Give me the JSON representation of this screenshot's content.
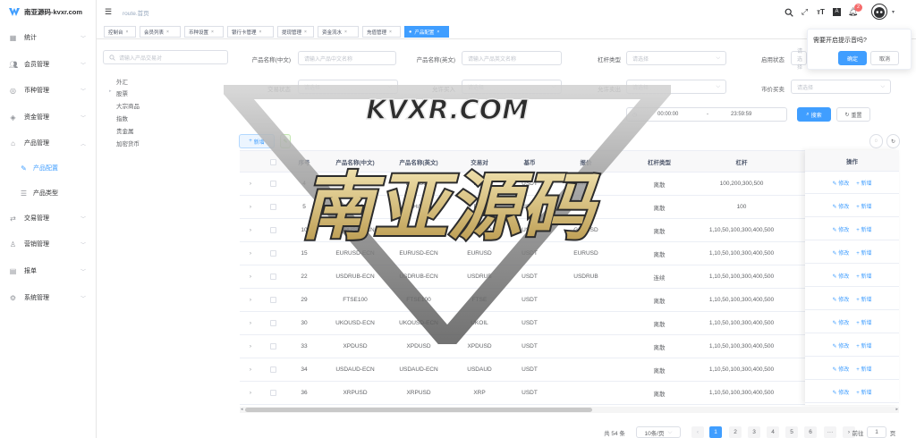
{
  "app": {
    "logo_text": "南亚源码-kvxr.com"
  },
  "sidebar": {
    "items": [
      {
        "label": "统计",
        "icon": "dashboard-icon"
      },
      {
        "label": "会员管理",
        "icon": "users-icon"
      },
      {
        "label": "币种管理",
        "icon": "coin-icon"
      },
      {
        "label": "资金管理",
        "icon": "money-icon"
      },
      {
        "label": "产品管理",
        "icon": "product-icon"
      },
      {
        "label": "产品配置",
        "icon": "edit-icon"
      },
      {
        "label": "产品类型",
        "icon": "list-icon"
      },
      {
        "label": "交易管理",
        "icon": "trade-icon"
      },
      {
        "label": "营销管理",
        "icon": "marketing-icon"
      },
      {
        "label": "报单",
        "icon": "report-icon"
      },
      {
        "label": "系统管理",
        "icon": "settings-icon"
      }
    ]
  },
  "header": {
    "breadcrumb": "route.首页",
    "notification_count": "2"
  },
  "tabs": [
    {
      "label": "控制台"
    },
    {
      "label": "会员列表"
    },
    {
      "label": "币种设置"
    },
    {
      "label": "银行卡管理"
    },
    {
      "label": "提现管理"
    },
    {
      "label": "资金流水"
    },
    {
      "label": "充值管理"
    },
    {
      "label": "产品配置"
    }
  ],
  "tree": {
    "placeholder": "请输入产品交易对",
    "nodes": [
      "外汇",
      "股票",
      "大宗商品",
      "指数",
      "贵金属",
      "加密货币"
    ]
  },
  "filters": {
    "name_cn_label": "产品名称(中文)",
    "name_cn_placeholder": "请输入产品中文名称",
    "name_en_label": "产品名称(英文)",
    "name_en_placeholder": "请输入产品英文名称",
    "leverage_type_label": "杠杆类型",
    "select_placeholder": "请选择",
    "enabled_label": "启用状态",
    "trade_status_label": "交易状态",
    "allow_buy_label": "允许买入",
    "allow_sell_label": "允许卖出",
    "market_buy_label": "市价买卖",
    "time_start": "00:00:00",
    "time_sep": "-",
    "time_end": "23:59:59",
    "search_button": "搜索",
    "reset_button": "重置",
    "add_button": "新增"
  },
  "popover": {
    "title": "需要开启提示音吗?",
    "confirm": "确定",
    "cancel": "取消"
  },
  "table": {
    "columns": [
      "序号",
      "产品名称(中文)",
      "产品名称(英文)",
      "交易对",
      "基币",
      "报价",
      "杠杆类型",
      "杠杆",
      "止损比例",
      "操作"
    ],
    "edit_label": "修改",
    "add_label": "新增",
    "rows": [
      {
        "id": "4",
        "name_cn": "BTC/USD",
        "name_en": "BTC/USD",
        "pair": "BTC",
        "base": "USDT",
        "quote": "Bitcoin",
        "lev_type": "离散",
        "leverage": "100,200,300,500",
        "stop": "0"
      },
      {
        "id": "5",
        "name_cn": "ETH/USD",
        "name_en": "ETH/USD",
        "pair": "ETH",
        "base": "USDT",
        "quote": "Ethereum",
        "lev_type": "离散",
        "leverage": "100",
        "stop": "10"
      },
      {
        "id": "10",
        "name_cn": "GBPUSD-ECN",
        "name_en": "GBPUSD-ECN",
        "pair": "GBPUSD",
        "base": "USDT",
        "quote": "GBPUSD",
        "lev_type": "离散",
        "leverage": "1,10,50,100,300,400,500",
        "stop": "0"
      },
      {
        "id": "15",
        "name_cn": "EURUSD-ECN",
        "name_en": "EURUSD-ECN",
        "pair": "EURUSD",
        "base": "USDT",
        "quote": "EURUSD",
        "lev_type": "离散",
        "leverage": "1,10,50,100,300,400,500",
        "stop": "0"
      },
      {
        "id": "22",
        "name_cn": "USDRUB-ECN",
        "name_en": "USDRUB-ECN",
        "pair": "USDRUB",
        "base": "USDT",
        "quote": "USDRUB",
        "lev_type": "连续",
        "leverage": "1,10,50,100,300,400,500",
        "stop": "0"
      },
      {
        "id": "29",
        "name_cn": "FTSE100",
        "name_en": "FTSE100",
        "pair": "FTSE",
        "base": "USDT",
        "quote": "",
        "lev_type": "离散",
        "leverage": "1,10,50,100,300,400,500",
        "stop": "0"
      },
      {
        "id": "30",
        "name_cn": "UKOUSD-ECN",
        "name_en": "UKOUSD-ECN",
        "pair": "UKOIL",
        "base": "USDT",
        "quote": "",
        "lev_type": "离散",
        "leverage": "1,10,50,100,300,400,500",
        "stop": "0"
      },
      {
        "id": "33",
        "name_cn": "XPDUSD",
        "name_en": "XPDUSD",
        "pair": "XPDUSD",
        "base": "USDT",
        "quote": "",
        "lev_type": "离散",
        "leverage": "1,10,50,100,300,400,500",
        "stop": "0"
      },
      {
        "id": "34",
        "name_cn": "USDAUD-ECN",
        "name_en": "USDAUD-ECN",
        "pair": "USDAUD",
        "base": "USDT",
        "quote": "",
        "lev_type": "离散",
        "leverage": "1,10,50,100,300,400,500",
        "stop": "0"
      },
      {
        "id": "36",
        "name_cn": "XRPUSD",
        "name_en": "XRPUSD",
        "pair": "XRP",
        "base": "USDT",
        "quote": "",
        "lev_type": "离散",
        "leverage": "1,10,50,100,300,400,500",
        "stop": "0"
      }
    ]
  },
  "pagination": {
    "total": "共 54 条",
    "page_size": "10条/页",
    "pages": [
      "1",
      "2",
      "3",
      "4",
      "5",
      "6"
    ],
    "ellipsis": "···",
    "goto_label": "前往",
    "goto_value": "1",
    "goto_suffix": "页"
  },
  "watermark": {
    "top_text": "KVXR.COM",
    "main_text": "南亚源码"
  },
  "colors": {
    "primary": "#409eff",
    "badge": "#f56c6c"
  }
}
